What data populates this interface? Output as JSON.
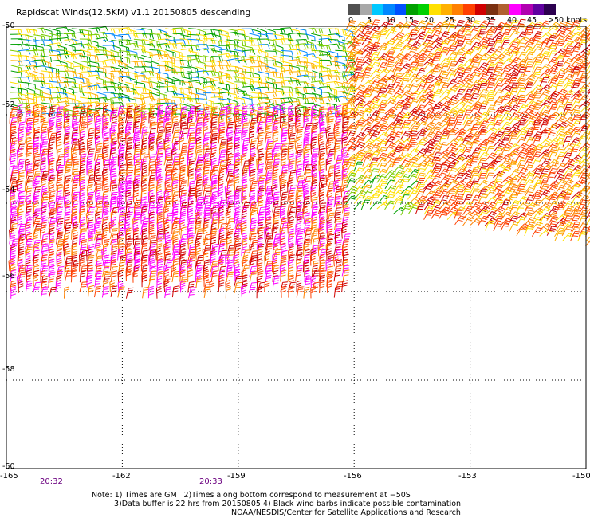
{
  "header": {
    "title": "Rapidscat Winds(12.5KM) v1.1 20150805 descending"
  },
  "legend": {
    "colors": [
      "#505050",
      "#a8a8a8",
      "#00c8ff",
      "#0088ff",
      "#0050ff",
      "#00a000",
      "#00d000",
      "#ffe000",
      "#ffb000",
      "#ff8000",
      "#ff4000",
      "#d00000",
      "#7a3010",
      "#b06030",
      "#ff00ff",
      "#b000b0",
      "#6000a0",
      "#2c0050"
    ],
    "labels": [
      "0",
      "5",
      "10",
      "15",
      "20",
      "25",
      "30",
      "35",
      "40",
      "45",
      ">50 knots"
    ]
  },
  "map": {
    "latitude_labels": [
      "-50",
      "-52",
      "-54",
      "-56",
      "-58",
      "-60"
    ],
    "longitude_labels": [
      "-165",
      "-162",
      "-159",
      "-156",
      "-153",
      "-150"
    ],
    "time_labels": [
      "20:32",
      "20:33"
    ],
    "wind_regions": [
      {
        "name": "north-strip",
        "lon": [
          -165,
          -156.3
        ],
        "lat": [
          -50,
          -52
        ],
        "speed_knots": [
          12,
          24
        ],
        "dominant_color": "yellow-green"
      },
      {
        "name": "west-block",
        "lon": [
          -165,
          -156.3
        ],
        "lat": [
          -52,
          -56.2
        ],
        "speed_knots": [
          24,
          40
        ],
        "dominant_color": "red"
      },
      {
        "name": "east-block",
        "lon": [
          -156.3,
          -150
        ],
        "lat": [
          -50,
          -55.4
        ],
        "speed_knots": [
          18,
          34
        ],
        "dominant_color": "orange"
      }
    ]
  },
  "notes": {
    "line1": "Note: 1) Times are GMT 2)Times along bottom correspond to measurement at −50S",
    "line2": "3)Data buffer is 22 hrs from 20150805 4) Black wind barbs indicate possible contamination",
    "line3": "NOAA/NESDIS/Center for Satellite Applications and Research"
  }
}
